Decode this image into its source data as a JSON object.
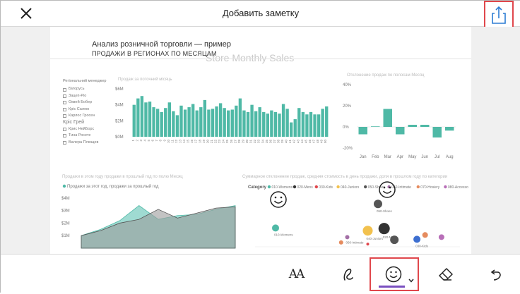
{
  "header": {
    "title": "Добавить заметку",
    "close_icon": "close-icon",
    "share_icon": "share-icon"
  },
  "report": {
    "title": "Анализ розничной торговли — пример",
    "subtitle": "ПРОДАЖИ В РЕГИОНАХ ПО МЕСЯЦАМ",
    "ghost_title": "Store Monthly Sales",
    "filter_header": "Регіональний менеджер",
    "filter_items": [
      "Білорусь",
      "Зацеп-Ріо",
      "Оквей Бобер",
      "Кріс Салем",
      "Карлос Гросен",
      "Кріс Грей",
      "Крис НейБорс",
      "Тина Росете",
      "Валера Плющев"
    ],
    "bar_chart_label": "Продаж за поточний місяць",
    "variance_chart_label": "Отклонение продаж по полосам Месяц",
    "area_chart_label": "Продажи в этом году продажи в прошлый год по полю Месяц",
    "area_legend": "Продажи за этот год, продажи за прошлый год",
    "scatter_chart_label": "Суммарное отклонение продаж, средняя стоимость в день продажи, доля в прошлом году по категории",
    "scatter_category_label": "Category"
  },
  "chart_data": [
    {
      "type": "bar",
      "title": "",
      "categories": [
        "1",
        "2",
        "3",
        "4",
        "5",
        "6",
        "7",
        "8",
        "9",
        "10",
        "11",
        "12",
        "13",
        "14",
        "15",
        "16",
        "17",
        "18",
        "19",
        "20",
        "21",
        "22",
        "23",
        "24",
        "25",
        "26",
        "27",
        "28",
        "29",
        "30",
        "31",
        "32",
        "33",
        "34",
        "35",
        "36",
        "37",
        "38",
        "39",
        "40",
        "41",
        "42",
        "43",
        "44",
        "45",
        "46",
        "47",
        "48",
        "49",
        "50"
      ],
      "values": [
        4.0,
        4.8,
        5.1,
        4.3,
        4.4,
        3.7,
        3.5,
        3.1,
        3.6,
        4.3,
        3.2,
        2.7,
        3.9,
        3.4,
        3.7,
        4.1,
        3.3,
        3.7,
        4.6,
        3.4,
        3.5,
        3.8,
        4.2,
        3.6,
        3.3,
        3.4,
        3.9,
        4.8,
        3.3,
        3.1,
        4.0,
        3.2,
        3.7,
        3.1,
        2.9,
        3.3,
        3.1,
        2.9,
        4.1,
        3.5,
        1.8,
        2.2,
        3.6,
        3.1,
        2.8,
        3.1,
        2.8,
        2.8,
        3.5,
        3.8
      ],
      "ylim": [
        0,
        6
      ],
      "yticks": [
        "$0M",
        "$2M",
        "$4M",
        "$6M"
      ],
      "color": "#4fb9a6"
    },
    {
      "type": "bar",
      "title": "",
      "categories": [
        "Jan",
        "Feb",
        "Mar",
        "Apr",
        "May",
        "Jun",
        "Jul",
        "Aug"
      ],
      "values": [
        -7,
        0.5,
        17,
        -7,
        2,
        2,
        -10,
        -3.5
      ],
      "ylim": [
        -20,
        40
      ],
      "yticks": [
        "40%",
        "20%",
        "0%",
        "-20%"
      ],
      "color": "#4fb9a6"
    },
    {
      "type": "area",
      "title": "",
      "yticks": [
        "$4M",
        "$3M",
        "$2M",
        "$1M"
      ],
      "series": [
        {
          "name": "this year",
          "values": [
            1.0,
            1.5,
            2.2,
            3.4,
            2.3,
            2.6,
            2.7,
            3.1,
            3.4
          ],
          "color": "#7fcfc3"
        },
        {
          "name": "last year",
          "values": [
            1.0,
            1.4,
            2.0,
            2.3,
            3.1,
            2.4,
            2.8,
            3.2,
            3.3
          ],
          "color": "#9b9b9b"
        }
      ],
      "ylim": [
        0,
        4.5
      ]
    },
    {
      "type": "scatter",
      "title": "",
      "legend": [
        "010-Womens",
        "020-Mens",
        "030-Kids",
        "040-Juniors",
        "050-Shoes",
        "060-Intimate",
        "070-Hosiery",
        "080-Accessories"
      ],
      "legend_colors": [
        "#4fb9a6",
        "#333333",
        "#e0474c",
        "#f2c14e",
        "#555555",
        "#a36fa6",
        "#e58b5e",
        "#b86fb8"
      ],
      "points": [
        {
          "label": "050-Shoes",
          "x": 0.6,
          "y": 0.8,
          "size": 6,
          "color": "#555555"
        },
        {
          "label": "010-Womens",
          "x": 0.1,
          "y": 0.35,
          "size": 5,
          "color": "#4fb9a6"
        },
        {
          "label": "040-Juniors",
          "x": 0.55,
          "y": 0.3,
          "size": 7,
          "color": "#f2c14e"
        },
        {
          "label": "020-Mens",
          "x": 0.63,
          "y": 0.34,
          "size": 8,
          "color": "#333333"
        },
        {
          "label": "060-Intimate",
          "x": 0.45,
          "y": 0.18,
          "size": 3,
          "color": "#a36fa6"
        },
        {
          "label": "",
          "x": 0.42,
          "y": 0.08,
          "size": 3,
          "color": "#e58b5e"
        },
        {
          "label": "",
          "x": 0.55,
          "y": 0.05,
          "size": 2,
          "color": "#e0474c"
        },
        {
          "label": "",
          "x": 0.68,
          "y": 0.13,
          "size": 6,
          "color": "#555555"
        },
        {
          "label": "030-Kids",
          "x": 0.79,
          "y": 0.14,
          "size": 5,
          "color": "#3d6fd0"
        },
        {
          "label": "",
          "x": 0.83,
          "y": 0.22,
          "size": 4,
          "color": "#e58b5e"
        },
        {
          "label": "",
          "x": 0.91,
          "y": 0.18,
          "size": 4,
          "color": "#b86fb8"
        }
      ]
    }
  ],
  "toolbar": {
    "tools": [
      "text-tool",
      "pen-tool",
      "emoji-tool",
      "eraser-tool",
      "undo-tool"
    ],
    "text_tool_label": "AA"
  }
}
